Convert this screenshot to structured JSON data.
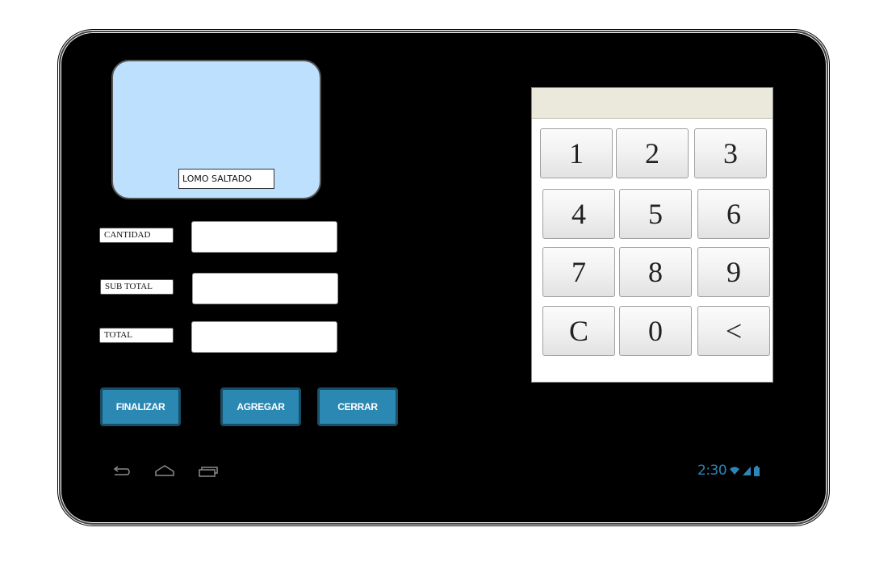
{
  "dish": {
    "name": "LOMO SALTADO"
  },
  "form": {
    "cantidad_label": "CANTIDAD",
    "cantidad_value": "",
    "subtotal_label": "SUB TOTAL",
    "subtotal_value": "",
    "total_label": "TOTAL",
    "total_value": ""
  },
  "actions": {
    "finalizar": "FINALIZAR",
    "agregar": "AGREGAR",
    "cerrar": "CERRAR"
  },
  "keypad": {
    "display": "",
    "keys": [
      "1",
      "2",
      "3",
      "4",
      "5",
      "6",
      "7",
      "8",
      "9",
      "C",
      "0",
      "<"
    ]
  },
  "status_bar": {
    "time": "2:30"
  },
  "icons": {
    "nav_back": "back-icon",
    "nav_home": "home-icon",
    "nav_recent": "recent-apps-icon",
    "wifi": "wifi-icon",
    "signal": "signal-icon",
    "battery": "battery-icon"
  },
  "colors": {
    "accent": "#2b88b2",
    "image_bg": "#bde0fe",
    "status": "#2d86b8",
    "screen": "#000000"
  }
}
